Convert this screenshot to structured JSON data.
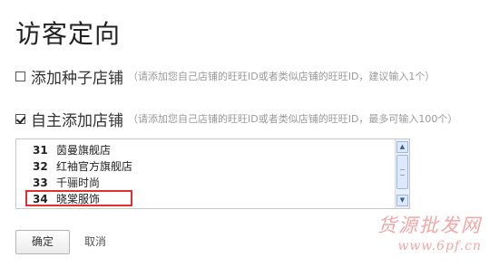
{
  "page": {
    "title": "访客定向"
  },
  "options": [
    {
      "label": "添加种子店铺",
      "hint": "（请添加您自己店铺的旺旺ID或者类似店铺的旺旺ID，建议输入1个）",
      "checked": false
    },
    {
      "label": "自主添加店铺",
      "hint": "（请添加您自己店铺的旺旺ID或者类似店铺的旺旺ID，最多可输入100个）",
      "checked": true
    }
  ],
  "shop_list": {
    "rows": [
      {
        "num": "31",
        "name": "茵曼旗舰店"
      },
      {
        "num": "32",
        "name": "红袖官方旗舰店"
      },
      {
        "num": "33",
        "name": "千骊时尚"
      },
      {
        "num": "34",
        "name": "晓棠服饰"
      }
    ],
    "highlighted_row": "34",
    "scroll_up_icon": "triangle-up",
    "scroll_down_icon": "triangle-down"
  },
  "buttons": {
    "ok": "确定",
    "cancel": "取消"
  },
  "watermark": {
    "text": "货源批发网",
    "url": "www.6pf.cn",
    "color": "#f4a6a6"
  },
  "colors": {
    "highlight_border": "#e03030"
  }
}
